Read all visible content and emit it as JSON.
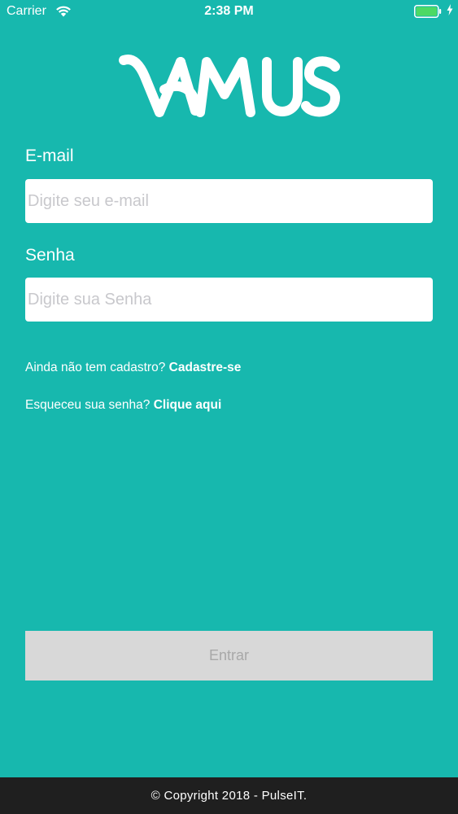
{
  "status_bar": {
    "carrier": "Carrier",
    "time": "2:38 PM"
  },
  "brand": {
    "logo_text": "VAMUS"
  },
  "form": {
    "email": {
      "label": "E-mail",
      "placeholder": "Digite seu e-mail",
      "value": ""
    },
    "password": {
      "label": "Senha",
      "placeholder": "Digite sua Senha",
      "value": ""
    },
    "signup": {
      "prompt": "Ainda não tem cadastro?",
      "link": "Cadastre-se"
    },
    "forgot": {
      "prompt": "Esqueceu sua senha?",
      "link": "Clique aqui"
    },
    "submit_label": "Entrar"
  },
  "footer": {
    "text": "© Copyright 2018 - PulseIT."
  },
  "colors": {
    "background": "#17b8ae",
    "input_background": "#ffffff",
    "button_disabled": "#d8d8d8",
    "button_text_disabled": "#a8a8a8",
    "footer_background": "#1f1f1f",
    "battery": "#4cd964"
  },
  "icons": {
    "wifi": "wifi-icon",
    "battery": "battery-icon",
    "charging": "charging-bolt-icon"
  }
}
